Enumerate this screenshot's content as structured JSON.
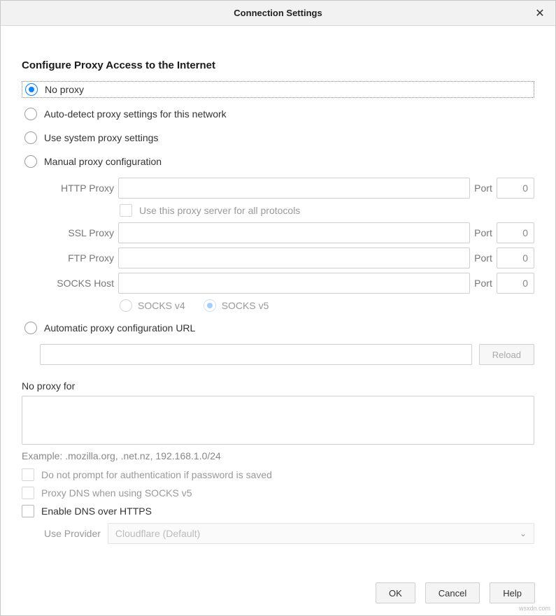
{
  "title": "Connection Settings",
  "heading": "Configure Proxy Access to the Internet",
  "proxy_modes": {
    "no_proxy": "No proxy",
    "auto_detect": "Auto-detect proxy settings for this network",
    "system": "Use system proxy settings",
    "manual": "Manual proxy configuration",
    "auto_url": "Automatic proxy configuration URL"
  },
  "manual": {
    "http_label": "HTTP Proxy",
    "ssl_label": "SSL Proxy",
    "ftp_label": "FTP Proxy",
    "socks_label": "SOCKS Host",
    "http": "",
    "http_port": "0",
    "ssl": "",
    "ssl_port": "0",
    "ftp": "",
    "ftp_port": "0",
    "socks": "",
    "socks_port": "0",
    "port_label": "Port",
    "use_all_label": "Use this proxy server for all protocols",
    "socks_v4": "SOCKS v4",
    "socks_v5": "SOCKS v5"
  },
  "auto_url": {
    "value": "",
    "reload": "Reload"
  },
  "no_proxy_for": {
    "label": "No proxy for",
    "value": "",
    "example": "Example: .mozilla.org, .net.nz, 192.168.1.0/24"
  },
  "options": {
    "no_prompt": "Do not prompt for authentication if password is saved",
    "proxy_dns": "Proxy DNS when using SOCKS v5",
    "enable_doh": "Enable DNS over HTTPS",
    "provider_label": "Use Provider",
    "provider_value": "Cloudflare (Default)"
  },
  "buttons": {
    "ok": "OK",
    "cancel": "Cancel",
    "help": "Help"
  },
  "watermark": "wsxdn.com"
}
